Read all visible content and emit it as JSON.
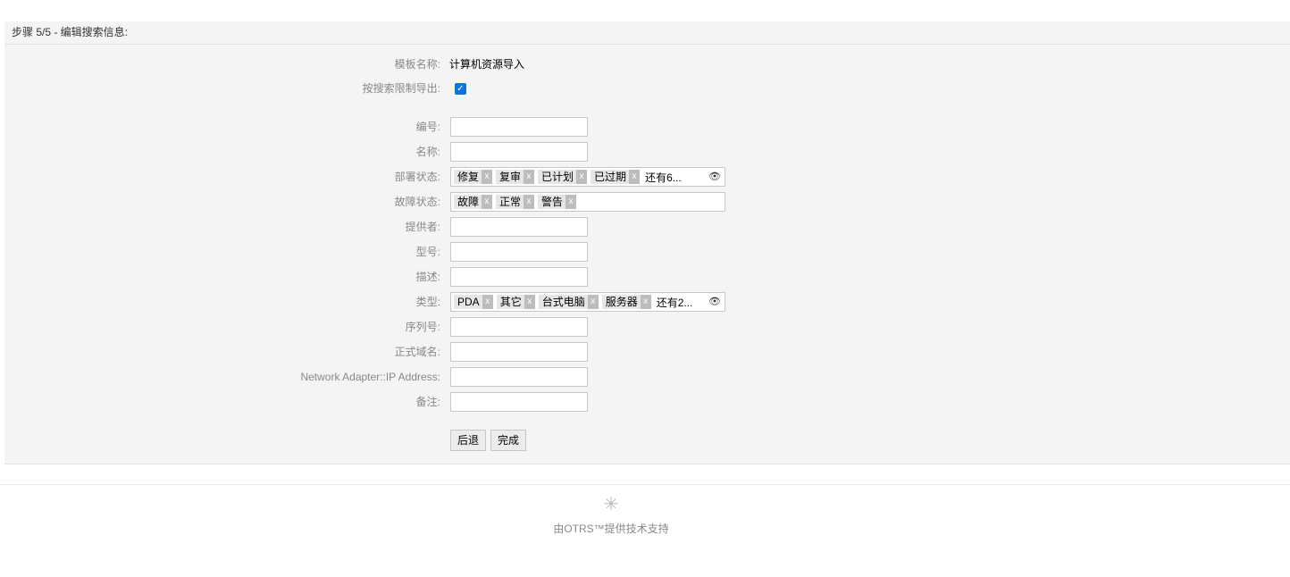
{
  "panel": {
    "header": "步骤 5/5 - 编辑搜索信息:"
  },
  "template": {
    "name_label": "模板名称:",
    "name_value": "计算机资源导入",
    "restrict_label": "按搜索限制导出:",
    "restrict_checked": true
  },
  "fields": {
    "number_label": "编号:",
    "name_label": "名称:",
    "deploy_state_label": "部署状态:",
    "deploy_state_tags": [
      "修复",
      "复审",
      "已计划",
      "已过期"
    ],
    "deploy_state_more": "还有6...",
    "incident_state_label": "故障状态:",
    "incident_state_tags": [
      "故障",
      "正常",
      "警告"
    ],
    "vendor_label": "提供者:",
    "model_label": "型号:",
    "description_label": "描述:",
    "type_label": "类型:",
    "type_tags": [
      "PDA",
      "其它",
      "台式电脑",
      "服务器"
    ],
    "type_more": "还有2...",
    "serial_label": "序列号:",
    "fqdn_label": "正式域名:",
    "ip_label": "Network Adapter::IP Address:",
    "note_label": "备注:"
  },
  "buttons": {
    "back": "后退",
    "finish": "完成"
  },
  "footer": {
    "powered_by": "由OTRS™提供技术支持"
  },
  "colors": {
    "panel_bg": "#f4f4f4",
    "checkbox": "#0b74de",
    "label": "#888888"
  }
}
